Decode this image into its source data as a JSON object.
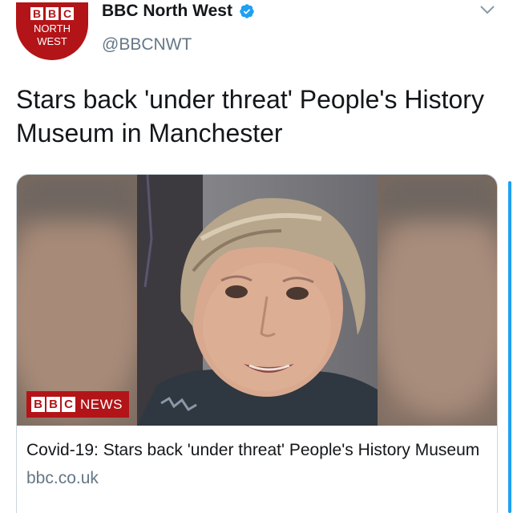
{
  "account": {
    "avatar": {
      "blocks": [
        "B",
        "B",
        "C"
      ],
      "region_line1": "NORTH",
      "region_line2": "WEST"
    },
    "display_name": "BBC North West",
    "handle": "@BBCNWT",
    "verified_icon": "verified-badge-icon",
    "menu_icon": "chevron-down-icon"
  },
  "tweet": {
    "text": "Stars back 'under threat' People's History Museum in Manchester"
  },
  "card": {
    "media_overlay": {
      "blocks": [
        "B",
        "B",
        "C"
      ],
      "word": "NEWS"
    },
    "title": "Covid-19: Stars back 'under threat' People's History Museum",
    "domain": "bbc.co.uk"
  },
  "colors": {
    "bbc_red": "#b31418",
    "verified_blue": "#1da1f2",
    "secondary_text": "#657786"
  }
}
